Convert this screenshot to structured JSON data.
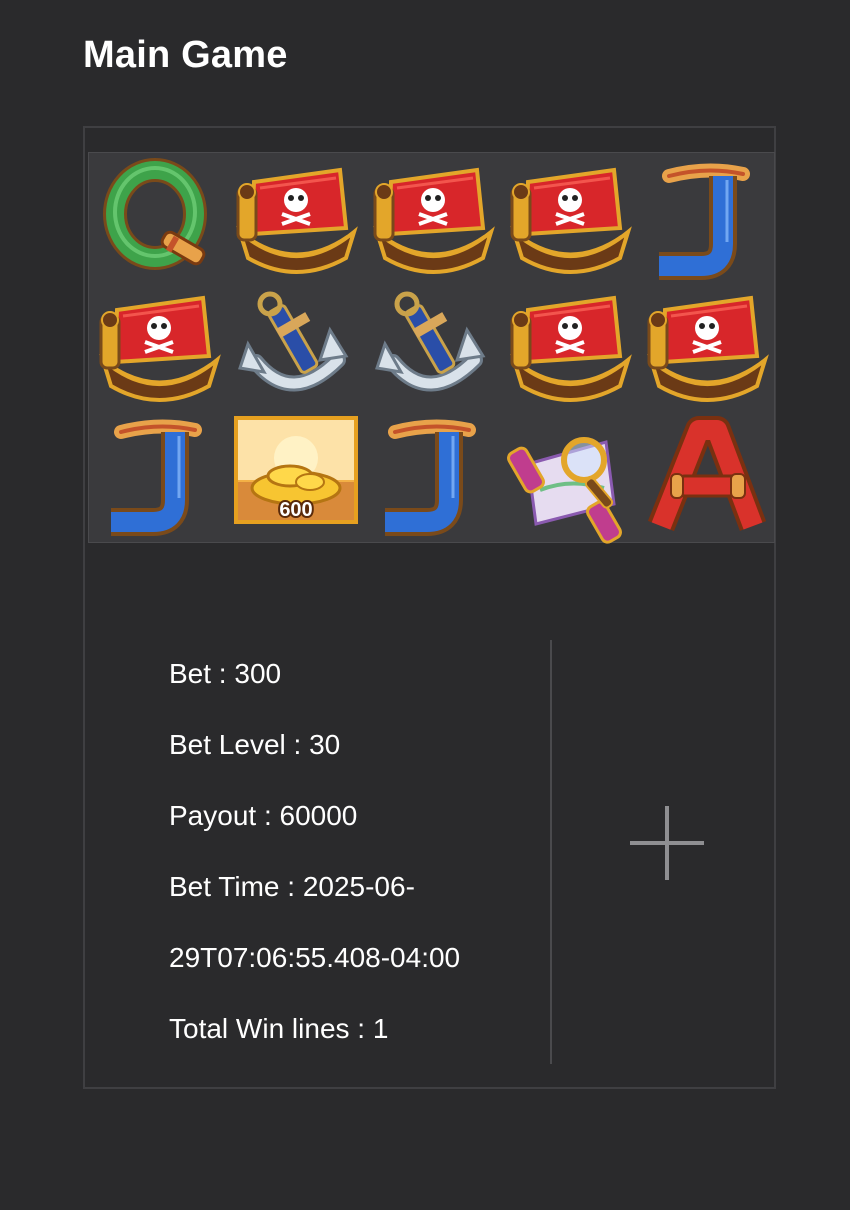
{
  "page": {
    "title": "Main Game"
  },
  "reels": {
    "rows": [
      [
        {
          "symbol": "Q",
          "icon": "letter-q-icon"
        },
        {
          "symbol": "pirate-ship",
          "icon": "pirate-ship-icon"
        },
        {
          "symbol": "pirate-ship",
          "icon": "pirate-ship-icon"
        },
        {
          "symbol": "pirate-ship",
          "icon": "pirate-ship-icon"
        },
        {
          "symbol": "J",
          "icon": "letter-j-icon"
        }
      ],
      [
        {
          "symbol": "pirate-ship",
          "icon": "pirate-ship-icon"
        },
        {
          "symbol": "anchor",
          "icon": "anchor-icon"
        },
        {
          "symbol": "anchor",
          "icon": "anchor-icon"
        },
        {
          "symbol": "pirate-ship",
          "icon": "pirate-ship-icon"
        },
        {
          "symbol": "pirate-ship",
          "icon": "pirate-ship-icon"
        }
      ],
      [
        {
          "symbol": "J",
          "icon": "letter-j-icon"
        },
        {
          "symbol": "gold-pile",
          "icon": "gold-treasure-icon",
          "value": "600"
        },
        {
          "symbol": "J",
          "icon": "letter-j-icon"
        },
        {
          "symbol": "treasure-map",
          "icon": "treasure-map-icon"
        },
        {
          "symbol": "A",
          "icon": "letter-a-icon"
        }
      ]
    ]
  },
  "details": {
    "bet": "Bet : 300",
    "bet_level": "Bet Level : 30",
    "payout": "Payout : 60000",
    "bet_time_line1": "Bet Time : 2025-06-",
    "bet_time_line2": "29T07:06:55.408-04:00",
    "total_win_lines": "Total Win lines : 1"
  },
  "actions": {
    "expand_icon": "plus-icon"
  },
  "colors": {
    "background": "#2a2a2c",
    "reel_background": "#3a3a3d",
    "sail_red": "#d8262a",
    "gold": "#e3a62a",
    "letter_blue": "#2f6fd6",
    "letter_green": "#3ea34a",
    "letter_red": "#d9322b"
  }
}
